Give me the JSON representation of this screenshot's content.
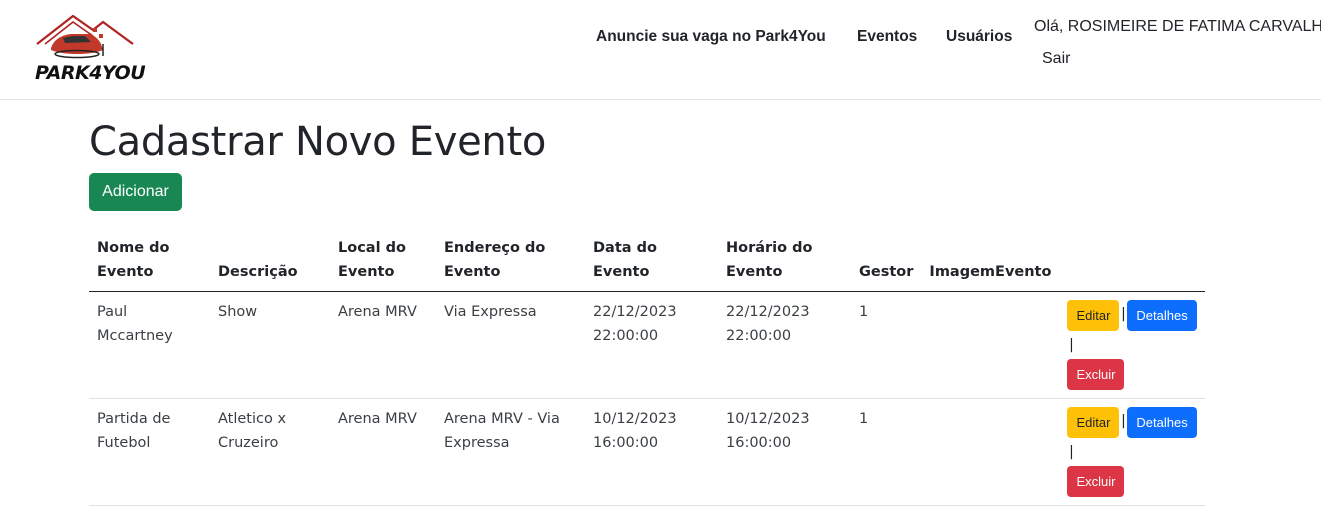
{
  "brand": {
    "name": "PARK4YOU",
    "colors": {
      "house": "#b22222",
      "car": "#c0392b"
    }
  },
  "nav": {
    "links": [
      "Anuncie sua vaga no Park4You",
      "Eventos",
      "Usuários"
    ],
    "greeting": "Olá, ROSIMEIRE DE FATIMA CARVALHO",
    "logout": "Sair"
  },
  "page": {
    "title": "Cadastrar Novo Evento",
    "add_button": "Adicionar"
  },
  "table": {
    "headers": [
      "Nome do Evento",
      "Descrição",
      "Local do Evento",
      "Endereço do Evento",
      "Data do Evento",
      "Horário do Evento",
      "Gestor",
      "ImagemEvento",
      ""
    ],
    "rows": [
      {
        "nome": "Paul Mccartney",
        "descricao": "Show",
        "local": "Arena MRV",
        "endereco": "Via Expressa",
        "data": "22/12/2023 22:00:00",
        "horario": "22/12/2023 22:00:00",
        "gestor": "1",
        "imagem": ""
      },
      {
        "nome": "Partida de Futebol",
        "descricao": "Atletico x Cruzeiro",
        "local": "Arena MRV",
        "endereco": "Arena MRV - Via Expressa",
        "data": "10/12/2023 16:00:00",
        "horario": "10/12/2023 16:00:00",
        "gestor": "1",
        "imagem": ""
      }
    ],
    "actions": {
      "edit": "Editar",
      "details": "Detalhes",
      "delete": "Excluir",
      "separator": "|"
    }
  },
  "theme": {
    "success": "#198754",
    "warning": "#ffc107",
    "primary": "#0d6efd",
    "danger": "#dc3545"
  }
}
